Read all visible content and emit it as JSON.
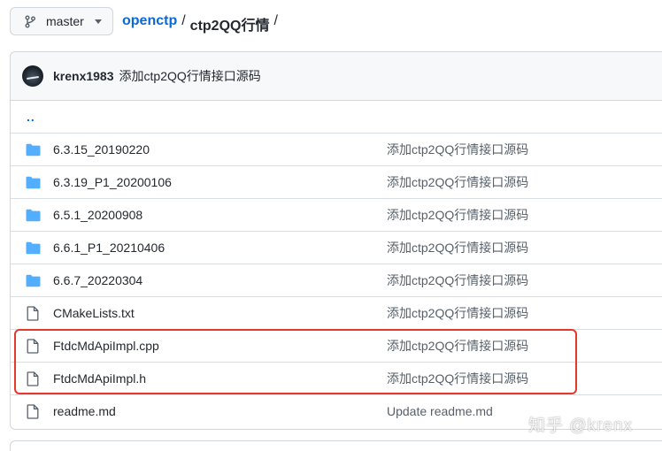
{
  "branch": {
    "label": "master"
  },
  "breadcrumb": {
    "repo": "openctp",
    "sep1": "/",
    "dir": "ctp2QQ行情",
    "sep2": "/"
  },
  "commit": {
    "author": "krenx1983",
    "message": "添加ctp2QQ行情接口源码"
  },
  "parent": {
    "label": ".."
  },
  "files": [
    {
      "type": "folder",
      "name": "6.3.15_20190220",
      "message": "添加ctp2QQ行情接口源码"
    },
    {
      "type": "folder",
      "name": "6.3.19_P1_20200106",
      "message": "添加ctp2QQ行情接口源码"
    },
    {
      "type": "folder",
      "name": "6.5.1_20200908",
      "message": "添加ctp2QQ行情接口源码"
    },
    {
      "type": "folder",
      "name": "6.6.1_P1_20210406",
      "message": "添加ctp2QQ行情接口源码"
    },
    {
      "type": "folder",
      "name": "6.6.7_20220304",
      "message": "添加ctp2QQ行情接口源码"
    },
    {
      "type": "file",
      "name": "CMakeLists.txt",
      "message": "添加ctp2QQ行情接口源码"
    },
    {
      "type": "file",
      "name": "FtdcMdApiImpl.cpp",
      "message": "添加ctp2QQ行情接口源码"
    },
    {
      "type": "file",
      "name": "FtdcMdApiImpl.h",
      "message": "添加ctp2QQ行情接口源码"
    },
    {
      "type": "file",
      "name": "readme.md",
      "message": "Update readme.md"
    }
  ],
  "watermark": "知乎 @krenx",
  "colors": {
    "link": "#0969da",
    "folder": "#54aeff",
    "highlight": "#e4392b"
  }
}
